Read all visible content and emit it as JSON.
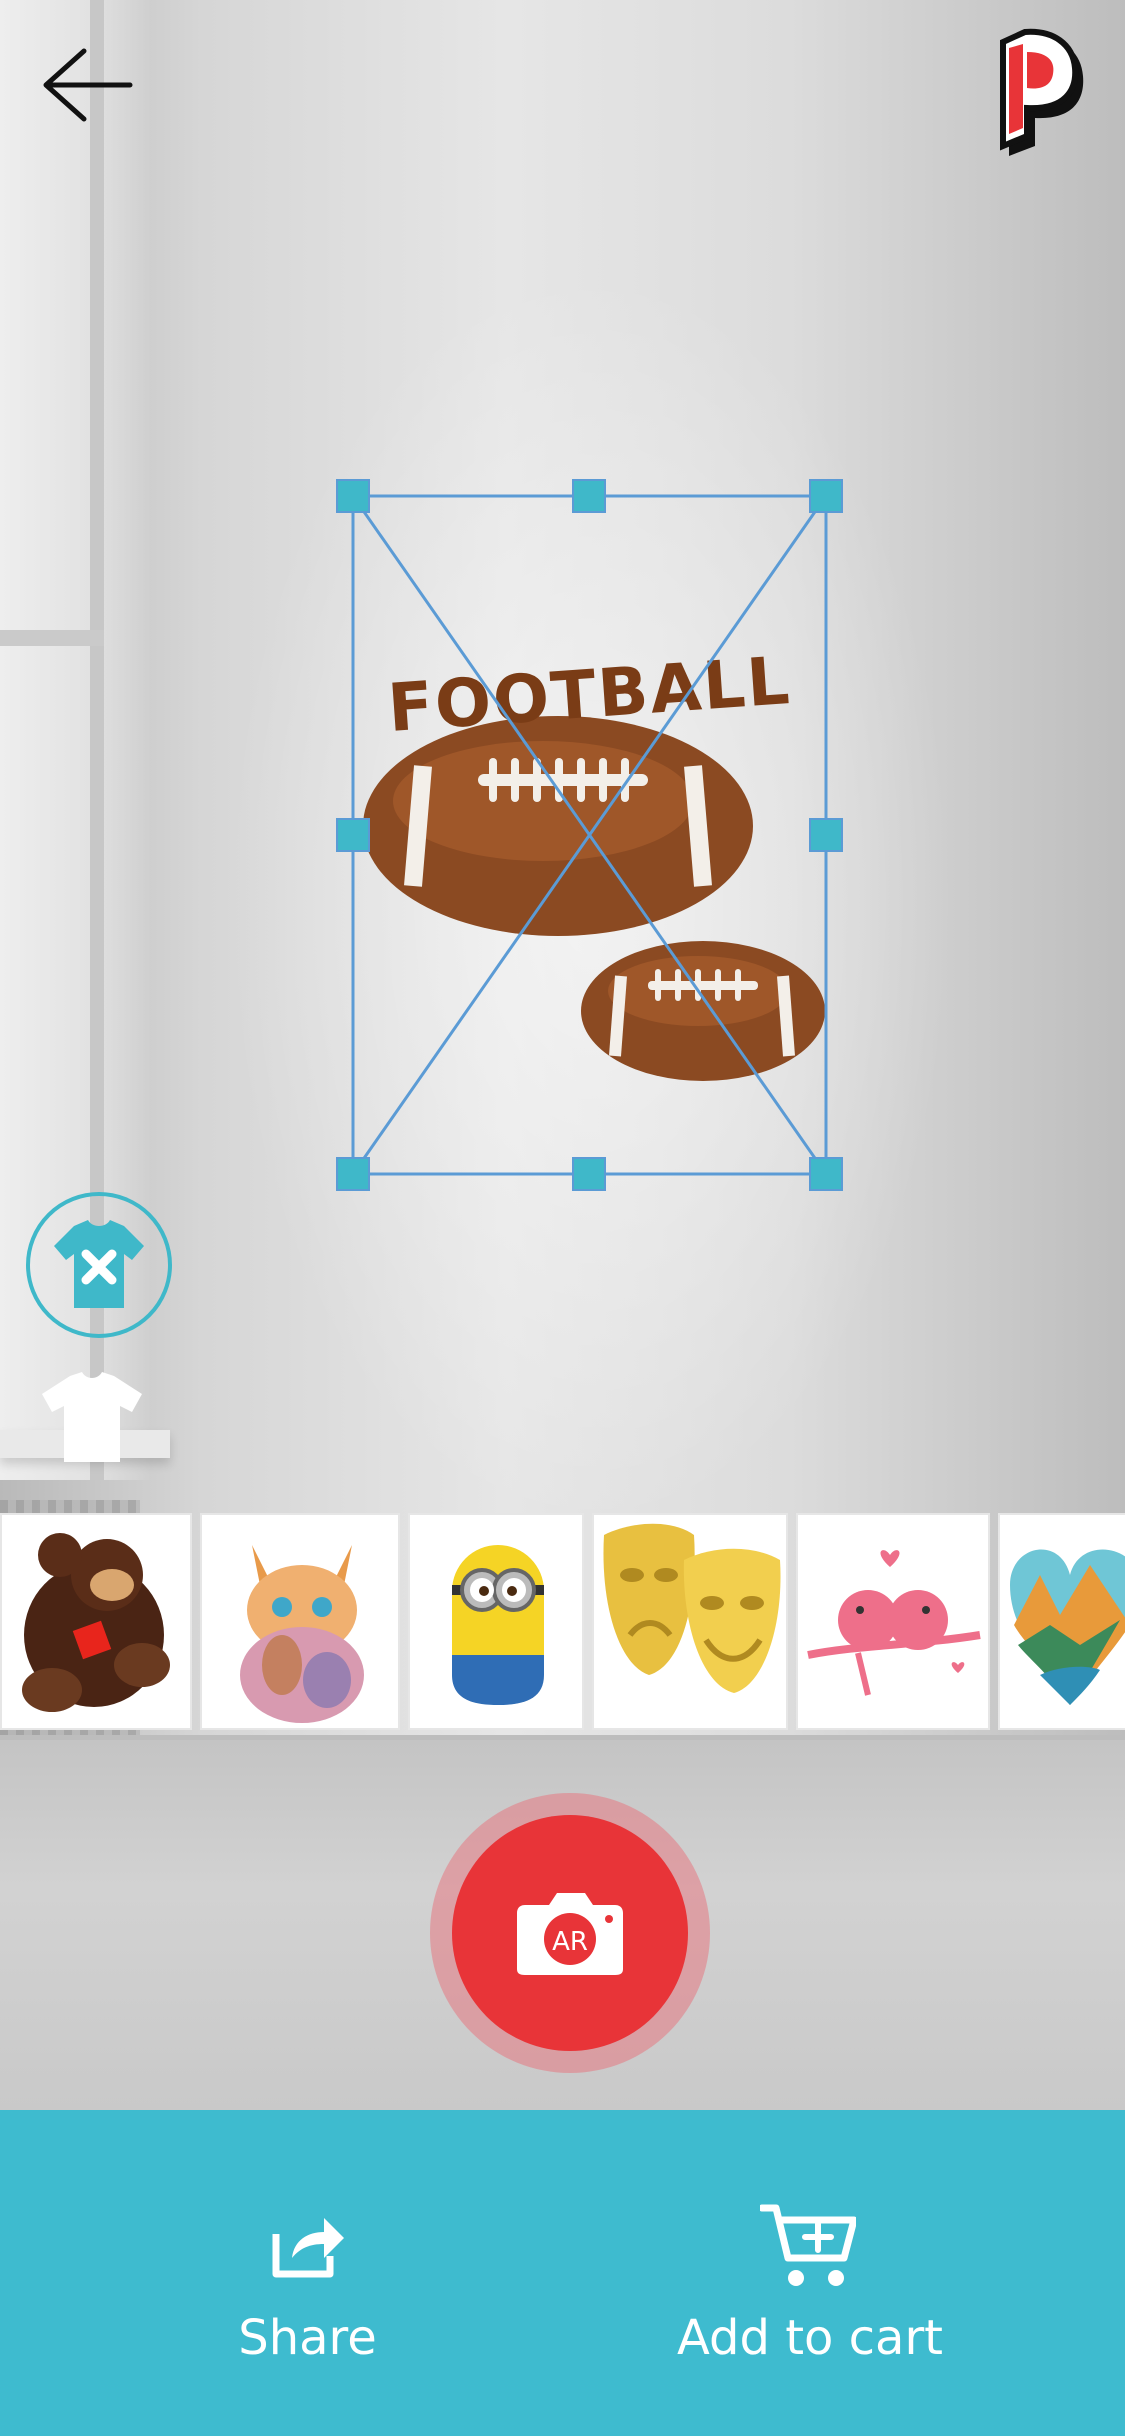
{
  "header": {
    "back_icon": "arrow-left-icon",
    "logo_icon": "p-logo-icon",
    "logo_colors": [
      "#e83438",
      "#ffffff",
      "#111111"
    ]
  },
  "design": {
    "text": "FOOTBALL",
    "selection_color": "#5b9bd5",
    "handle_color": "#3fb8c9"
  },
  "toggles": {
    "remove_shirt_icon": "tshirt-remove-icon",
    "shirt_icon": "tshirt-icon"
  },
  "designs": [
    {
      "name": "gorilla-design"
    },
    {
      "name": "kitten-design"
    },
    {
      "name": "minion-design"
    },
    {
      "name": "theater-masks-design"
    },
    {
      "name": "love-birds-design"
    },
    {
      "name": "heart-landscape-design"
    }
  ],
  "capture": {
    "label": "AR",
    "icon": "camera-icon",
    "color": "#e83438"
  },
  "bottom_bar": {
    "color": "#3ebbcf",
    "share_label": "Share",
    "share_icon": "share-icon",
    "cart_label": "Add to cart",
    "cart_icon": "add-to-cart-icon"
  }
}
